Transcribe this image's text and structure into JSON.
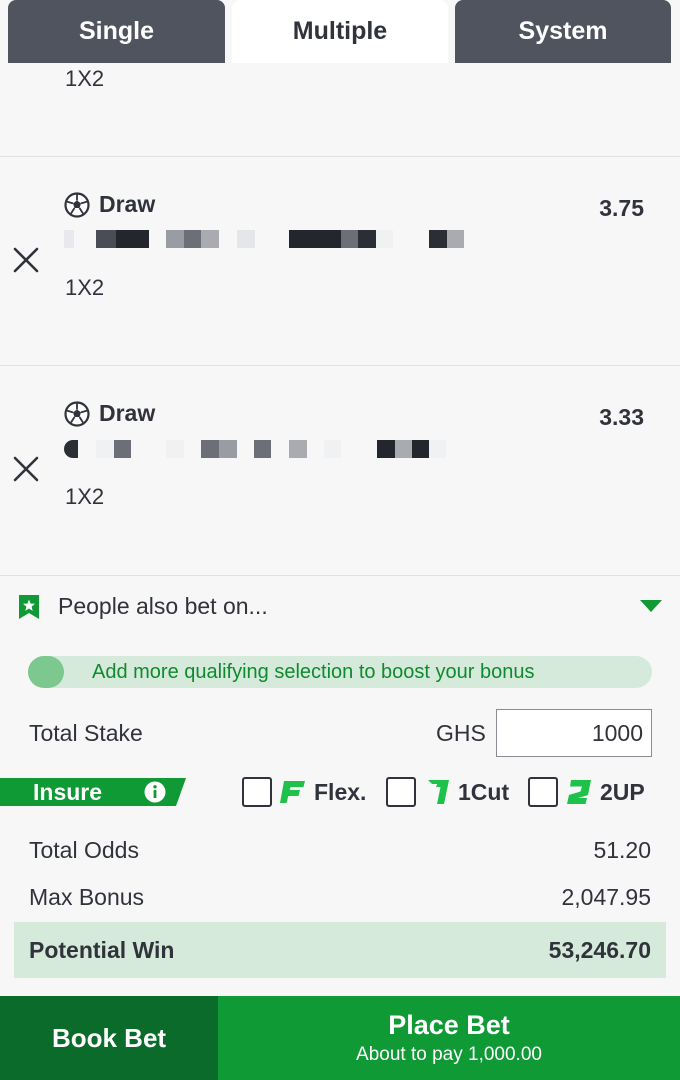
{
  "tabs": [
    {
      "label": "Single",
      "active": false
    },
    {
      "label": "Multiple",
      "active": true
    },
    {
      "label": "System",
      "active": false
    }
  ],
  "selections": [
    {
      "pick": "",
      "market": "1X2",
      "odds": ""
    },
    {
      "pick": "Draw",
      "market": "1X2",
      "odds": "3.75",
      "icon": "soccer-ball-icon"
    },
    {
      "pick": "Draw",
      "market": "1X2",
      "odds": "3.33",
      "icon": "soccer-ball-icon"
    }
  ],
  "people_also_bet": {
    "label": "People also bet on...",
    "icon": "bookmark-star-icon"
  },
  "bonus_bar": {
    "text": "Add more qualifying selection to boost your bonus"
  },
  "stake": {
    "label": "Total Stake",
    "currency": "GHS",
    "value": "1000"
  },
  "insure": {
    "label": "Insure"
  },
  "options": [
    {
      "label": "Flex.",
      "icon": "flex-icon",
      "checked": false
    },
    {
      "label": "1Cut",
      "icon": "one-cut-icon",
      "checked": false
    },
    {
      "label": "2UP",
      "icon": "two-up-icon",
      "checked": false
    }
  ],
  "totals": {
    "total_odds_label": "Total Odds",
    "total_odds": "51.20",
    "max_bonus_label": "Max Bonus",
    "max_bonus": "2,047.95",
    "potential_win_label": "Potential Win",
    "potential_win": "53,246.70"
  },
  "buttons": {
    "book_bet": "Book Bet",
    "place_bet": "Place Bet",
    "place_bet_sub": "About to pay 1,000.00"
  },
  "colors": {
    "brand_green": "#0f9a36",
    "dark_green": "#0a6b2a",
    "light_green": "#d6eadb",
    "tab_inactive": "#50545e"
  }
}
